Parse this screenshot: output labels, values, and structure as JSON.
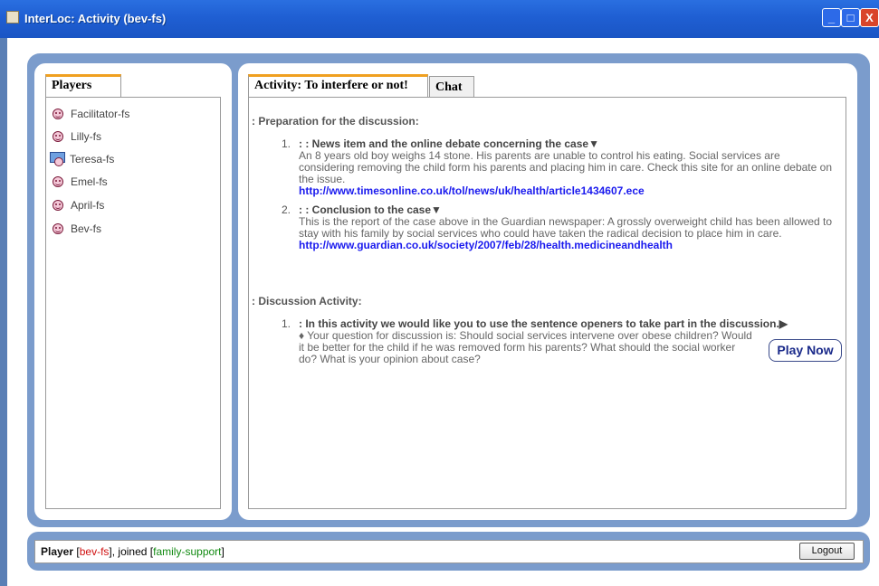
{
  "window": {
    "title": "InterLoc: Activity (bev-fs)",
    "min_label": "_",
    "max_label": "□",
    "close_label": "X"
  },
  "players_panel": {
    "tab_label": "Players",
    "players": [
      {
        "name": "Facilitator-fs",
        "icon": "smiley-icon"
      },
      {
        "name": "Lilly-fs",
        "icon": "smiley-icon"
      },
      {
        "name": "Teresa-fs",
        "icon": "facilitator-computer-icon"
      },
      {
        "name": "Emel-fs",
        "icon": "smiley-icon"
      },
      {
        "name": "April-fs",
        "icon": "smiley-icon"
      },
      {
        "name": "Bev-fs",
        "icon": "smiley-icon"
      }
    ]
  },
  "activity_panel": {
    "tabs": [
      {
        "label": "Activity: To interfere or not!",
        "active": true
      },
      {
        "label": "Chat",
        "active": false
      }
    ],
    "sections": [
      {
        "title": ": Preparation for the discussion:",
        "items": [
          {
            "number": "1.",
            "heading": ": : News item and the online debate concerning the case",
            "marker": "▼",
            "body": "An 8 years old boy weighs 14 stone. His parents are unable to control his eating. Social services are considering removing the child form his parents and placing him in care. Check this site for an online debate on the issue.",
            "link": "http://www.timesonline.co.uk/tol/news/uk/health/article1434607.ece"
          },
          {
            "number": "2.",
            "heading": ": : Conclusion to the case",
            "marker": "▼",
            "body": "This is the report of the case above in the Guardian newspaper: A grossly overweight child has been allowed to stay with his family by social services who could have taken the radical decision to place him in care.",
            "link": "http://www.guardian.co.uk/society/2007/feb/28/health.medicineandhealth"
          }
        ]
      },
      {
        "title": ": Discussion Activity:",
        "items": [
          {
            "number": "1.",
            "heading": ": In this activity we would like you to use the sentence openers to take part in the discussion.",
            "marker": "▶",
            "body": "♦ Your question for discussion is: Should social services intervene over obese children? Would it be better for the child if he was removed form his parents? What should the social worker do? What is your opinion about case?",
            "button": "Play Now"
          }
        ]
      }
    ]
  },
  "status_bar": {
    "player_label": "Player",
    "player_name": "bev-fs",
    "joined_text": ", joined",
    "group_name": "family-support",
    "logout_label": "Logout"
  },
  "colors": {
    "titlebar": "#1f5fd3",
    "panel_blue": "#7b9ccc",
    "link": "#1a1aee",
    "tab_accent": "#f0a020",
    "player_name_red": "#d01010",
    "group_green": "#118a11"
  }
}
